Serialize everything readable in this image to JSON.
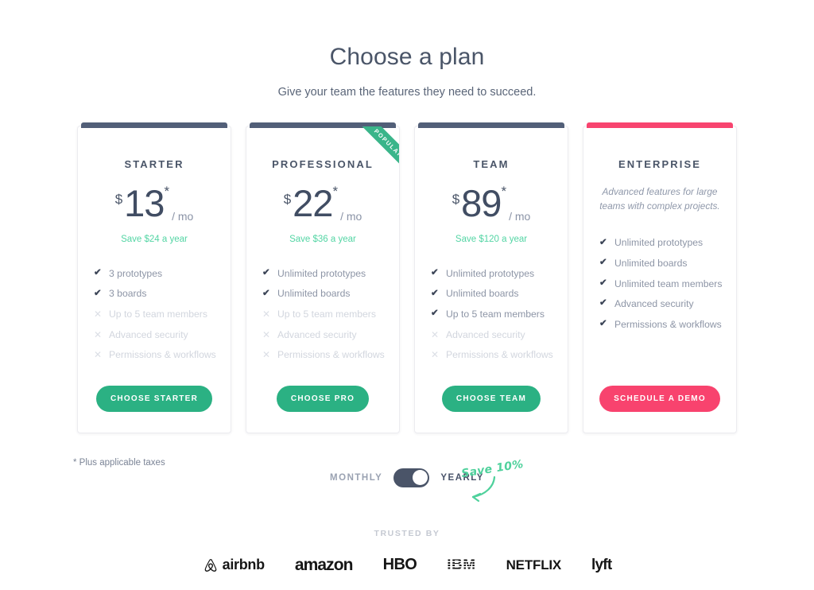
{
  "header": {
    "title": "Choose a plan",
    "subtitle": "Give your team the features they need to succeed."
  },
  "plans": [
    {
      "name": "STARTER",
      "currency": "$",
      "amount": "13",
      "asterisk": "*",
      "per": "/ mo",
      "save_note": "Save $24 a year",
      "accent": "#525f78",
      "ribbon": null,
      "description": null,
      "features": [
        {
          "label": "3 prototypes",
          "included": true
        },
        {
          "label": "3 boards",
          "included": true
        },
        {
          "label": "Up to 5 team members",
          "included": false
        },
        {
          "label": "Advanced security",
          "included": false
        },
        {
          "label": "Permissions & workflows",
          "included": false
        }
      ],
      "cta_label": "CHOOSE STARTER",
      "cta_color": "#2bb183"
    },
    {
      "name": "PROFESSIONAL",
      "currency": "$",
      "amount": "22",
      "asterisk": "*",
      "per": "/ mo",
      "save_note": "Save $36 a year",
      "accent": "#525f78",
      "ribbon": "POPULAR",
      "description": null,
      "features": [
        {
          "label": "Unlimited prototypes",
          "included": true
        },
        {
          "label": "Unlimited boards",
          "included": true
        },
        {
          "label": "Up to 5 team members",
          "included": false
        },
        {
          "label": "Advanced security",
          "included": false
        },
        {
          "label": "Permissions & workflows",
          "included": false
        }
      ],
      "cta_label": "CHOOSE PRO",
      "cta_color": "#2bb183"
    },
    {
      "name": "TEAM",
      "currency": "$",
      "amount": "89",
      "asterisk": "*",
      "per": "/ mo",
      "save_note": "Save $120 a year",
      "accent": "#525f78",
      "ribbon": null,
      "description": null,
      "features": [
        {
          "label": "Unlimited prototypes",
          "included": true
        },
        {
          "label": "Unlimited boards",
          "included": true
        },
        {
          "label": "Up to 5 team members",
          "included": true
        },
        {
          "label": "Advanced security",
          "included": false
        },
        {
          "label": "Permissions & workflows",
          "included": false
        }
      ],
      "cta_label": "CHOOSE TEAM",
      "cta_color": "#2bb183"
    },
    {
      "name": "ENTERPRISE",
      "currency": null,
      "amount": null,
      "asterisk": null,
      "per": null,
      "save_note": null,
      "accent": "#f8446f",
      "ribbon": null,
      "description": "Advanced features for large teams with complex projects.",
      "features": [
        {
          "label": "Unlimited prototypes",
          "included": true
        },
        {
          "label": "Unlimited boards",
          "included": true
        },
        {
          "label": "Unlimited team members",
          "included": true
        },
        {
          "label": "Advanced security",
          "included": true
        },
        {
          "label": "Permissions & workflows",
          "included": true
        }
      ],
      "cta_label": "SCHEDULE A DEMO",
      "cta_color": "#f8436e"
    }
  ],
  "footnote": "* Plus applicable taxes",
  "billing_toggle": {
    "left_label": "MONTHLY",
    "right_label": "YEARLY",
    "selected": "YEARLY",
    "save_badge": "Save 10%"
  },
  "trusted": {
    "title": "TRUSTED BY",
    "logos": [
      "airbnb",
      "amazon",
      "HBO",
      "IBM",
      "NETFLIX",
      "lyft"
    ]
  },
  "icons": {
    "check": "✔",
    "cross": "✕"
  }
}
